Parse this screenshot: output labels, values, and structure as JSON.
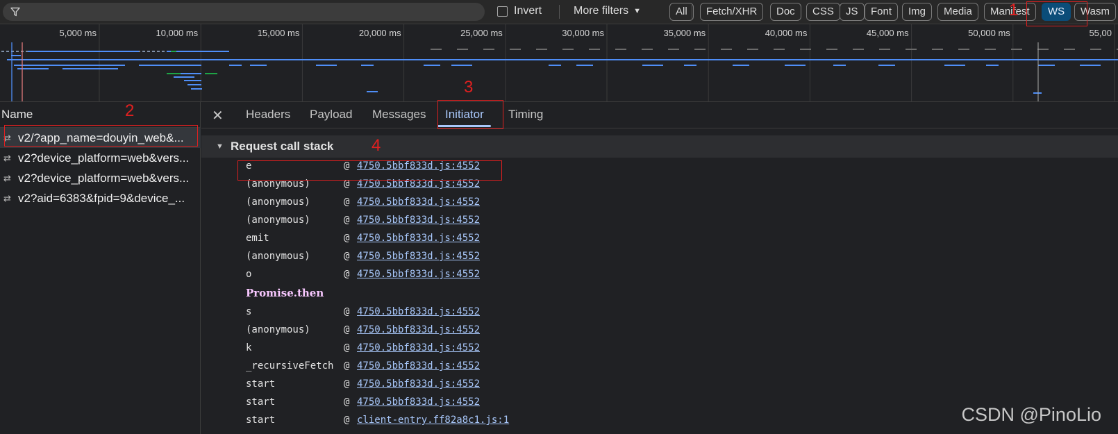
{
  "filter_bar": {
    "filter_placeholder": "",
    "invert_label": "Invert",
    "more_filters_label": "More filters",
    "type_buttons": [
      "All",
      "Fetch/XHR",
      "Doc",
      "CSS",
      "JS",
      "Font",
      "Img",
      "Media",
      "Manifest",
      "WS",
      "Wasm"
    ],
    "selected_type": "WS"
  },
  "overview": {
    "tick_labels": [
      "5,000 ms",
      "10,000 ms",
      "15,000 ms",
      "20,000 ms",
      "25,000 ms",
      "30,000 ms",
      "35,000 ms",
      "40,000 ms",
      "45,000 ms",
      "50,000 ms",
      "55,00"
    ]
  },
  "name_column": {
    "header": "Name",
    "requests": [
      {
        "icon": "websocket-icon",
        "name": "v2/?app_name=douyin_web&..."
      },
      {
        "icon": "websocket-icon",
        "name": "v2?device_platform=web&vers..."
      },
      {
        "icon": "websocket-icon",
        "name": "v2?device_platform=web&vers..."
      },
      {
        "icon": "websocket-icon",
        "name": "v2?aid=6383&fpid=9&device_..."
      }
    ]
  },
  "details": {
    "tabs": [
      "Headers",
      "Payload",
      "Messages",
      "Initiator",
      "Timing"
    ],
    "active_tab": "Initiator",
    "section_title": "Request call stack",
    "frames": [
      {
        "fn": "e",
        "at": "@",
        "loc": "4750.5bbf833d.js:4552"
      },
      {
        "fn": "(anonymous)",
        "at": "@",
        "loc": "4750.5bbf833d.js:4552"
      },
      {
        "fn": "(anonymous)",
        "at": "@",
        "loc": "4750.5bbf833d.js:4552"
      },
      {
        "fn": "(anonymous)",
        "at": "@",
        "loc": "4750.5bbf833d.js:4552"
      },
      {
        "fn": "emit",
        "at": "@",
        "loc": "4750.5bbf833d.js:4552"
      },
      {
        "fn": "(anonymous)",
        "at": "@",
        "loc": "4750.5bbf833d.js:4552"
      },
      {
        "fn": "o",
        "at": "@",
        "loc": "4750.5bbf833d.js:4552"
      }
    ],
    "async_label": "Promise.then",
    "frames_after": [
      {
        "fn": "s",
        "at": "@",
        "loc": "4750.5bbf833d.js:4552"
      },
      {
        "fn": "(anonymous)",
        "at": "@",
        "loc": "4750.5bbf833d.js:4552"
      },
      {
        "fn": "k",
        "at": "@",
        "loc": "4750.5bbf833d.js:4552"
      },
      {
        "fn": "_recursiveFetch",
        "at": "@",
        "loc": "4750.5bbf833d.js:4552"
      },
      {
        "fn": "start",
        "at": "@",
        "loc": "4750.5bbf833d.js:4552"
      },
      {
        "fn": "start",
        "at": "@",
        "loc": "4750.5bbf833d.js:4552"
      },
      {
        "fn": "start",
        "at": "@",
        "loc": "client-entry.ff82a8c1.js:1"
      }
    ]
  },
  "annotations": [
    "1",
    "2",
    "3",
    "4"
  ],
  "watermark": "CSDN @PinoLio",
  "colors": {
    "accent": "#a8c7fa",
    "selected_filter": "#0b4d79",
    "annotation_red": "#e02020",
    "timeline_bar": "#4f8ef7",
    "timeline_green": "#1ea446"
  }
}
